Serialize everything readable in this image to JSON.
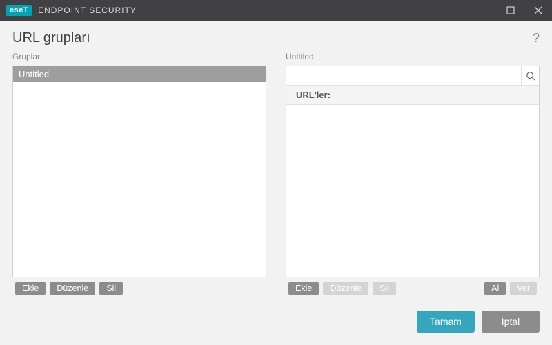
{
  "titlebar": {
    "brand_badge": "eseT",
    "brand_text": "ENDPOINT SECURITY"
  },
  "header": {
    "title": "URL grupları",
    "help": "?"
  },
  "left": {
    "label": "Gruplar",
    "items": [
      "Untitled"
    ],
    "toolbar": {
      "add": "Ekle",
      "edit": "Düzenle",
      "delete": "Sil"
    }
  },
  "right": {
    "label": "Untitled",
    "search_placeholder": "",
    "url_header": "URL'ler:",
    "toolbar": {
      "add": "Ekle",
      "edit": "Düzenle",
      "delete": "Sil",
      "import": "Al",
      "export": "Ver"
    }
  },
  "footer": {
    "ok": "Tamam",
    "cancel": "İptal"
  }
}
